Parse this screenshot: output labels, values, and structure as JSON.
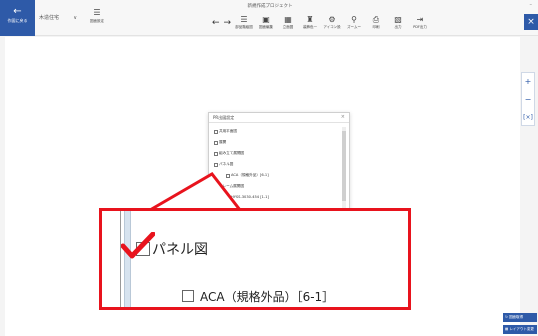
{
  "header": {
    "back_label": "作図に戻る",
    "plan_select": "木造住宅",
    "tool_settings": "図面設定",
    "app_title": "新規作成プロジェクト",
    "tools": [
      {
        "icon": "list-icon",
        "label": "部品階級図"
      },
      {
        "icon": "image-icon",
        "label": "図面編集"
      },
      {
        "icon": "grid-icon",
        "label": "立面図"
      },
      {
        "icon": "paint-icon",
        "label": "装飾色一"
      },
      {
        "icon": "gear-icon",
        "label": "アイコン設"
      },
      {
        "icon": "search-icon",
        "label": "ズームー"
      },
      {
        "icon": "print-icon",
        "label": "印刷"
      },
      {
        "icon": "save-icon",
        "label": "出力"
      },
      {
        "icon": "export-icon",
        "label": "PDF出力"
      }
    ]
  },
  "zoom_panel": {
    "zoom_in": "+",
    "zoom_out": "−",
    "fit": "[×]"
  },
  "bottom_buttons": {
    "primary": "図面取得",
    "secondary": "レイアウト変更"
  },
  "dialog": {
    "title": "PR出図設定",
    "items": [
      {
        "label": "共用平面図",
        "sub": false
      },
      {
        "label": "展開",
        "sub": false
      },
      {
        "label": "組み立て展開図",
        "sub": false
      },
      {
        "label": "パネル図",
        "sub": false
      },
      {
        "label": "ACA（規格外品）[6-1]",
        "sub": true
      },
      {
        "label": "フレーム展開図",
        "sub": false
      },
      {
        "label": "HYSS-3030-454 [1-1]",
        "sub": true
      }
    ]
  },
  "callout": {
    "main_label": "パネル図",
    "sub_label": "ACA（規格外品）［6-1］"
  },
  "colors": {
    "accent": "#2e5aa8",
    "highlight": "#e8131d"
  }
}
